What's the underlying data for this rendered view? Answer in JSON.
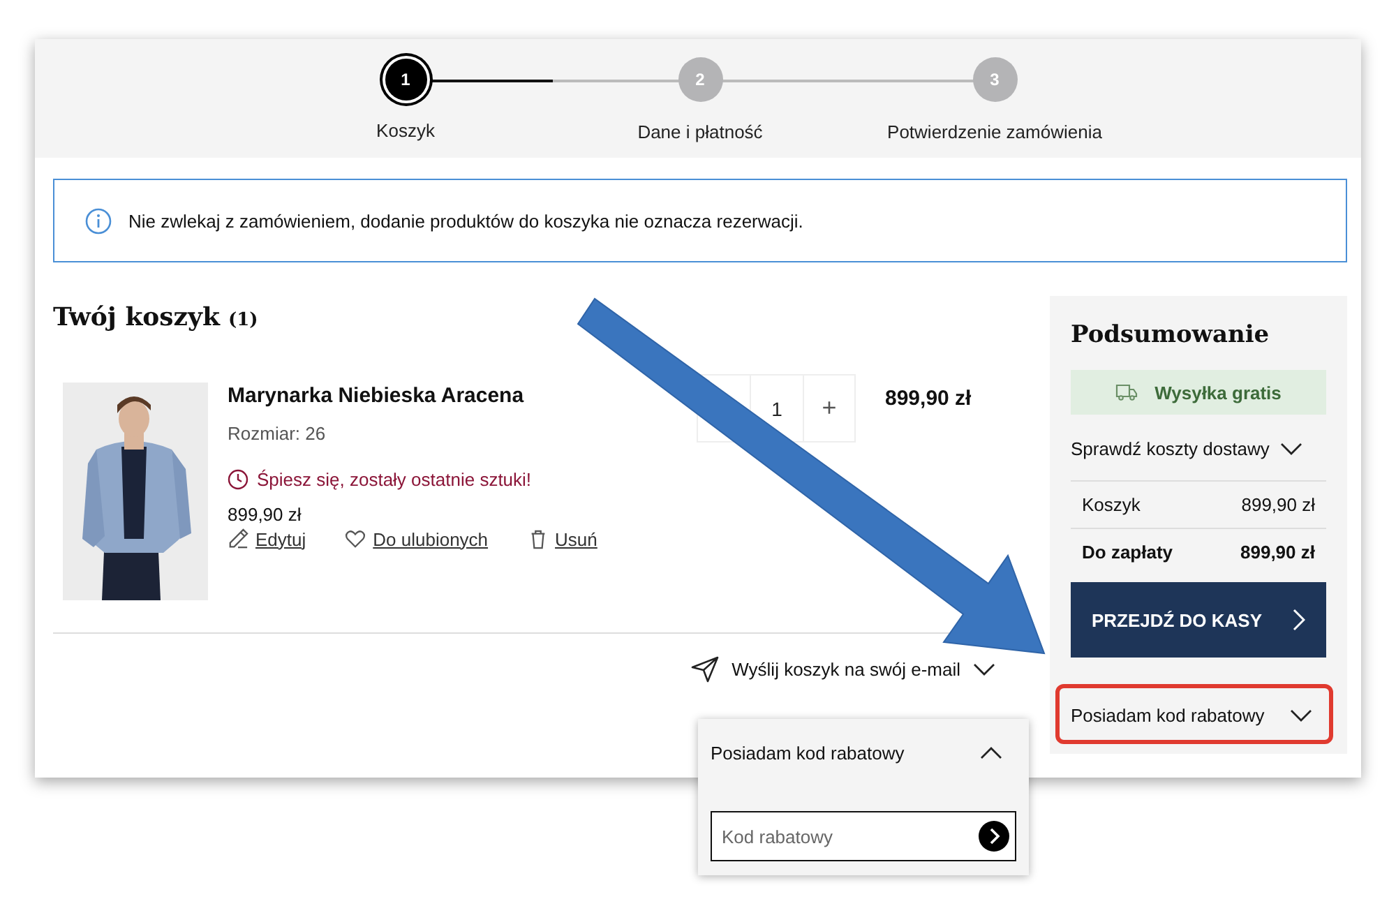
{
  "steps": [
    {
      "number": "1",
      "label": "Koszyk",
      "selected": true
    },
    {
      "number": "2",
      "label": "Dane i płatność",
      "selected": false
    },
    {
      "number": "3",
      "label": "Potwierdzenie zamówienia",
      "selected": false
    }
  ],
  "notice": "Nie zwlekaj z zamówieniem, dodanie produktów do koszyka nie oznacza rezerwacji.",
  "cart": {
    "title": "Twój koszyk",
    "count": "(1)",
    "items": [
      {
        "kind": "picture",
        "name": "Marynarka Niebieska Aracena",
        "size": "Rozmiar: 26",
        "alert": "Śpiesz się, zostały ostatnie sztuki!",
        "unit_price": "899,90 zł",
        "quantity": "1",
        "plus": "+",
        "price": "899,90 zł",
        "actions": [
          "Edytuj",
          "Do ulubionych",
          "Usuń"
        ]
      }
    ],
    "send_email": "Wyślij koszyk na swój e-mail"
  },
  "summary": {
    "title": "Podsumowanie",
    "shipping_badge": "Wysyłka gratis",
    "delivery_link": "Sprawdź koszty dostawy",
    "rows": [
      {
        "label": "Koszyk",
        "value": "899,90 zł",
        "kind": "normal"
      },
      {
        "label": "Do zapłaty",
        "value": "899,90 zł",
        "kind": "total"
      }
    ],
    "checkout_button": "PRZEJDŹ DO KASY",
    "coupon": {
      "label": "Posiadam kod rabatowy",
      "expanded": false
    }
  },
  "coupon_popup": {
    "title": "Posiadam kod rabatowy",
    "expanded": true,
    "placeholder": "Kod rabatowy"
  }
}
